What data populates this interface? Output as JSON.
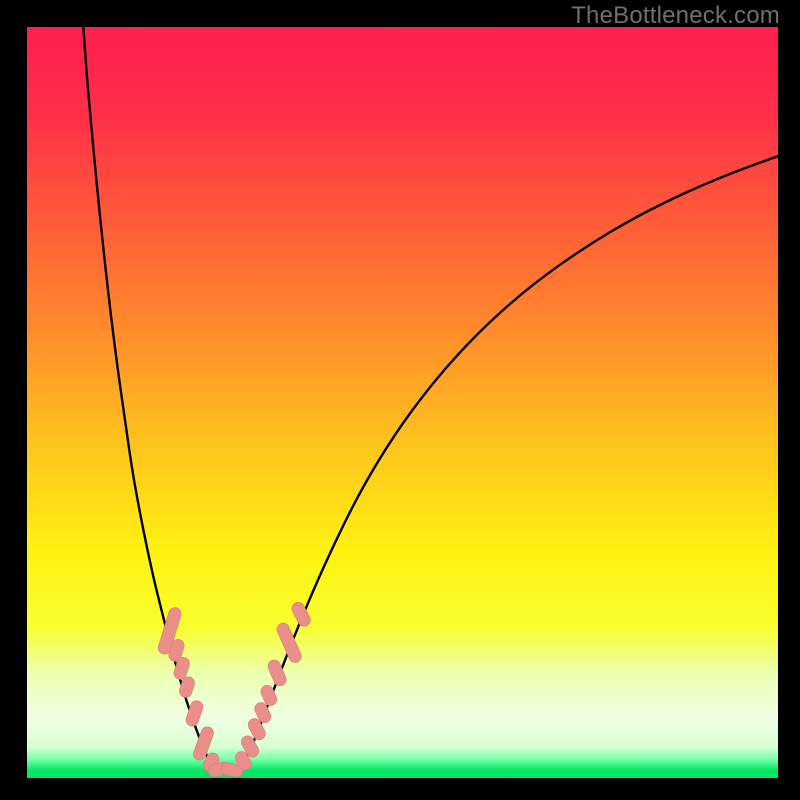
{
  "watermark": "TheBottleneck.com",
  "colors": {
    "black": "#000000",
    "curve": "#000000",
    "marker_fill": "#e98e89",
    "marker_stroke": "#d77d78",
    "watermark": "#6f6f6f",
    "green": "#00e763"
  },
  "gradient_stops": [
    {
      "offset": 0.0,
      "color": "#ff1f4e"
    },
    {
      "offset": 0.12,
      "color": "#ff3048"
    },
    {
      "offset": 0.25,
      "color": "#ff593a"
    },
    {
      "offset": 0.4,
      "color": "#ff8a2c"
    },
    {
      "offset": 0.55,
      "color": "#ffc21e"
    },
    {
      "offset": 0.7,
      "color": "#fff212"
    },
    {
      "offset": 0.8,
      "color": "#f9ff2f"
    },
    {
      "offset": 0.86,
      "color": "#ecffb0"
    },
    {
      "offset": 0.92,
      "color": "#f0ffe4"
    },
    {
      "offset": 0.958,
      "color": "#d9ffd3"
    },
    {
      "offset": 0.975,
      "color": "#77ffaa"
    },
    {
      "offset": 0.99,
      "color": "#00e763"
    },
    {
      "offset": 1.0,
      "color": "#00e763"
    }
  ],
  "chart_data": {
    "type": "line",
    "title": "",
    "xlabel": "",
    "ylabel": "",
    "xlim": [
      0,
      100
    ],
    "ylim": [
      0,
      100
    ],
    "series": [
      {
        "name": "left-branch",
        "x": [
          7.5,
          8,
          9,
          10,
          11,
          12,
          13,
          14,
          15,
          16,
          17,
          18,
          19,
          20,
          21,
          22,
          23,
          24,
          24.5
        ],
        "y": [
          100,
          93,
          82,
          72,
          63,
          55,
          48,
          41,
          35.5,
          30.5,
          26,
          22,
          18,
          14.5,
          11,
          8,
          5.2,
          2.8,
          1.8
        ]
      },
      {
        "name": "valley-floor",
        "x": [
          24.5,
          25,
          25.5,
          26,
          26.5,
          27,
          27.5,
          28,
          28.5
        ],
        "y": [
          1.8,
          1.3,
          1.05,
          0.95,
          0.92,
          0.95,
          1.05,
          1.25,
          1.6
        ]
      },
      {
        "name": "right-branch",
        "x": [
          28.5,
          30,
          32,
          34,
          36,
          38,
          40,
          43,
          46,
          50,
          55,
          60,
          65,
          70,
          75,
          80,
          85,
          90,
          95,
          100
        ],
        "y": [
          1.6,
          4.3,
          9.5,
          14.8,
          19.9,
          24.7,
          29.2,
          35.5,
          41.0,
          47.3,
          53.8,
          59.2,
          63.8,
          67.7,
          71.1,
          74.1,
          76.7,
          79.0,
          81.0,
          82.8
        ]
      }
    ],
    "markers": [
      {
        "name": "left-cluster",
        "points": [
          {
            "x": 19.0,
            "y": 19.6,
            "len": 6.4,
            "angle": -73
          },
          {
            "x": 19.9,
            "y": 17.0,
            "len": 3.0,
            "angle": -73
          },
          {
            "x": 20.6,
            "y": 14.6,
            "len": 3.0,
            "angle": -72
          },
          {
            "x": 21.3,
            "y": 12.1,
            "len": 2.8,
            "angle": -72
          },
          {
            "x": 22.3,
            "y": 8.6,
            "len": 3.5,
            "angle": -71
          },
          {
            "x": 23.5,
            "y": 4.6,
            "len": 4.6,
            "angle": -70
          },
          {
            "x": 24.5,
            "y": 2.1,
            "len": 2.6,
            "angle": -60
          }
        ]
      },
      {
        "name": "valley-cluster",
        "points": [
          {
            "x": 25.6,
            "y": 1.15,
            "len": 3.0,
            "angle": -12
          },
          {
            "x": 27.3,
            "y": 1.1,
            "len": 3.0,
            "angle": 10
          }
        ]
      },
      {
        "name": "right-cluster",
        "points": [
          {
            "x": 28.8,
            "y": 2.3,
            "len": 2.6,
            "angle": 58
          },
          {
            "x": 29.7,
            "y": 4.2,
            "len": 3.0,
            "angle": 60
          },
          {
            "x": 30.6,
            "y": 6.5,
            "len": 3.0,
            "angle": 62
          },
          {
            "x": 31.4,
            "y": 8.7,
            "len": 2.8,
            "angle": 64
          },
          {
            "x": 32.2,
            "y": 11.0,
            "len": 2.8,
            "angle": 66
          },
          {
            "x": 33.3,
            "y": 14.0,
            "len": 3.6,
            "angle": 67
          },
          {
            "x": 34.9,
            "y": 18.0,
            "len": 5.6,
            "angle": 66
          },
          {
            "x": 36.5,
            "y": 21.8,
            "len": 3.4,
            "angle": 63
          }
        ]
      }
    ]
  }
}
